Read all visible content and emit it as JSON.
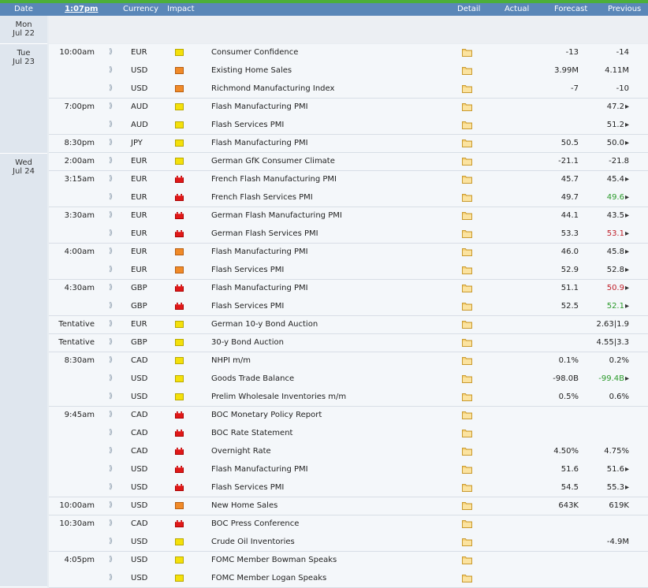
{
  "header": {
    "date": "Date",
    "time": "1:07pm",
    "currency": "Currency",
    "impact": "Impact",
    "detail": "Detail",
    "actual": "Actual",
    "forecast": "Forecast",
    "previous": "Previous"
  },
  "colors": {
    "top_bar": "#4caf3a",
    "header_bg": "#5a87b8",
    "previous_better": "#2a9a2a",
    "previous_worse": "#c0202a"
  },
  "icons": {
    "sound": "sound-icon",
    "detail": "folder-icon",
    "revised": "revised-arrow-icon"
  },
  "days": [
    {
      "dow": "Mon",
      "date": "Jul 22"
    },
    {
      "dow": "Tue",
      "date": "Jul 23"
    },
    {
      "dow": "Wed",
      "date": "Jul 24"
    }
  ],
  "rows": [
    {
      "time": "10:00am",
      "currency": "EUR",
      "impact": "yellow",
      "event": "Consumer Confidence",
      "forecast": "-13",
      "previous": "-14",
      "prev_class": ""
    },
    {
      "time": "",
      "currency": "USD",
      "impact": "orange",
      "event": "Existing Home Sales",
      "forecast": "3.99M",
      "previous": "4.11M",
      "prev_class": ""
    },
    {
      "time": "",
      "currency": "USD",
      "impact": "orange",
      "event": "Richmond Manufacturing Index",
      "forecast": "-7",
      "previous": "-10",
      "prev_class": ""
    },
    {
      "time": "7:00pm",
      "currency": "AUD",
      "impact": "yellow",
      "event": "Flash Manufacturing PMI",
      "forecast": "",
      "previous": "47.2",
      "prev_class": "",
      "arrow": true
    },
    {
      "time": "",
      "currency": "AUD",
      "impact": "yellow",
      "event": "Flash Services PMI",
      "forecast": "",
      "previous": "51.2",
      "prev_class": "",
      "arrow": true
    },
    {
      "time": "8:30pm",
      "currency": "JPY",
      "impact": "yellow",
      "event": "Flash Manufacturing PMI",
      "forecast": "50.5",
      "previous": "50.0",
      "prev_class": "",
      "arrow": true
    },
    {
      "time": "2:00am",
      "currency": "EUR",
      "impact": "yellow",
      "event": "German GfK Consumer Climate",
      "forecast": "-21.1",
      "previous": "-21.8",
      "prev_class": ""
    },
    {
      "time": "3:15am",
      "currency": "EUR",
      "impact": "red",
      "event": "French Flash Manufacturing PMI",
      "forecast": "45.7",
      "previous": "45.4",
      "prev_class": "",
      "arrow": true
    },
    {
      "time": "",
      "currency": "EUR",
      "impact": "red",
      "event": "French Flash Services PMI",
      "forecast": "49.7",
      "previous": "49.6",
      "prev_class": "up",
      "arrow": true
    },
    {
      "time": "3:30am",
      "currency": "EUR",
      "impact": "red",
      "event": "German Flash Manufacturing PMI",
      "forecast": "44.1",
      "previous": "43.5",
      "prev_class": "",
      "arrow": true
    },
    {
      "time": "",
      "currency": "EUR",
      "impact": "red",
      "event": "German Flash Services PMI",
      "forecast": "53.3",
      "previous": "53.1",
      "prev_class": "down",
      "arrow": true
    },
    {
      "time": "4:00am",
      "currency": "EUR",
      "impact": "orange",
      "event": "Flash Manufacturing PMI",
      "forecast": "46.0",
      "previous": "45.8",
      "prev_class": "",
      "arrow": true
    },
    {
      "time": "",
      "currency": "EUR",
      "impact": "orange",
      "event": "Flash Services PMI",
      "forecast": "52.9",
      "previous": "52.8",
      "prev_class": "",
      "arrow": true
    },
    {
      "time": "4:30am",
      "currency": "GBP",
      "impact": "red",
      "event": "Flash Manufacturing PMI",
      "forecast": "51.1",
      "previous": "50.9",
      "prev_class": "down",
      "arrow": true
    },
    {
      "time": "",
      "currency": "GBP",
      "impact": "red",
      "event": "Flash Services PMI",
      "forecast": "52.5",
      "previous": "52.1",
      "prev_class": "up",
      "arrow": true
    },
    {
      "time": "Tentative",
      "currency": "EUR",
      "impact": "yellow",
      "event": "German 10-y Bond Auction",
      "forecast": "",
      "previous": "2.63|1.9",
      "prev_class": ""
    },
    {
      "time": "Tentative",
      "currency": "GBP",
      "impact": "yellow",
      "event": "30-y Bond Auction",
      "forecast": "",
      "previous": "4.55|3.3",
      "prev_class": ""
    },
    {
      "time": "8:30am",
      "currency": "CAD",
      "impact": "yellow",
      "event": "NHPI m/m",
      "forecast": "0.1%",
      "previous": "0.2%",
      "prev_class": ""
    },
    {
      "time": "",
      "currency": "USD",
      "impact": "yellow",
      "event": "Goods Trade Balance",
      "forecast": "-98.0B",
      "previous": "-99.4B",
      "prev_class": "up",
      "arrow": true
    },
    {
      "time": "",
      "currency": "USD",
      "impact": "yellow",
      "event": "Prelim Wholesale Inventories m/m",
      "forecast": "0.5%",
      "previous": "0.6%",
      "prev_class": ""
    },
    {
      "time": "9:45am",
      "currency": "CAD",
      "impact": "red",
      "event": "BOC Monetary Policy Report",
      "forecast": "",
      "previous": "",
      "prev_class": ""
    },
    {
      "time": "",
      "currency": "CAD",
      "impact": "red",
      "event": "BOC Rate Statement",
      "forecast": "",
      "previous": "",
      "prev_class": ""
    },
    {
      "time": "",
      "currency": "CAD",
      "impact": "red",
      "event": "Overnight Rate",
      "forecast": "4.50%",
      "previous": "4.75%",
      "prev_class": ""
    },
    {
      "time": "",
      "currency": "USD",
      "impact": "red",
      "event": "Flash Manufacturing PMI",
      "forecast": "51.6",
      "previous": "51.6",
      "prev_class": "",
      "arrow": true
    },
    {
      "time": "",
      "currency": "USD",
      "impact": "red",
      "event": "Flash Services PMI",
      "forecast": "54.5",
      "previous": "55.3",
      "prev_class": "",
      "arrow": true
    },
    {
      "time": "10:00am",
      "currency": "USD",
      "impact": "orange",
      "event": "New Home Sales",
      "forecast": "643K",
      "previous": "619K",
      "prev_class": ""
    },
    {
      "time": "10:30am",
      "currency": "CAD",
      "impact": "red",
      "event": "BOC Press Conference",
      "forecast": "",
      "previous": "",
      "prev_class": ""
    },
    {
      "time": "",
      "currency": "USD",
      "impact": "yellow",
      "event": "Crude Oil Inventories",
      "forecast": "",
      "previous": "-4.9M",
      "prev_class": ""
    },
    {
      "time": "4:05pm",
      "currency": "USD",
      "impact": "yellow",
      "event": "FOMC Member Bowman Speaks",
      "forecast": "",
      "previous": "",
      "prev_class": ""
    },
    {
      "time": "",
      "currency": "USD",
      "impact": "yellow",
      "event": "FOMC Member Logan Speaks",
      "forecast": "",
      "previous": "",
      "prev_class": ""
    }
  ]
}
